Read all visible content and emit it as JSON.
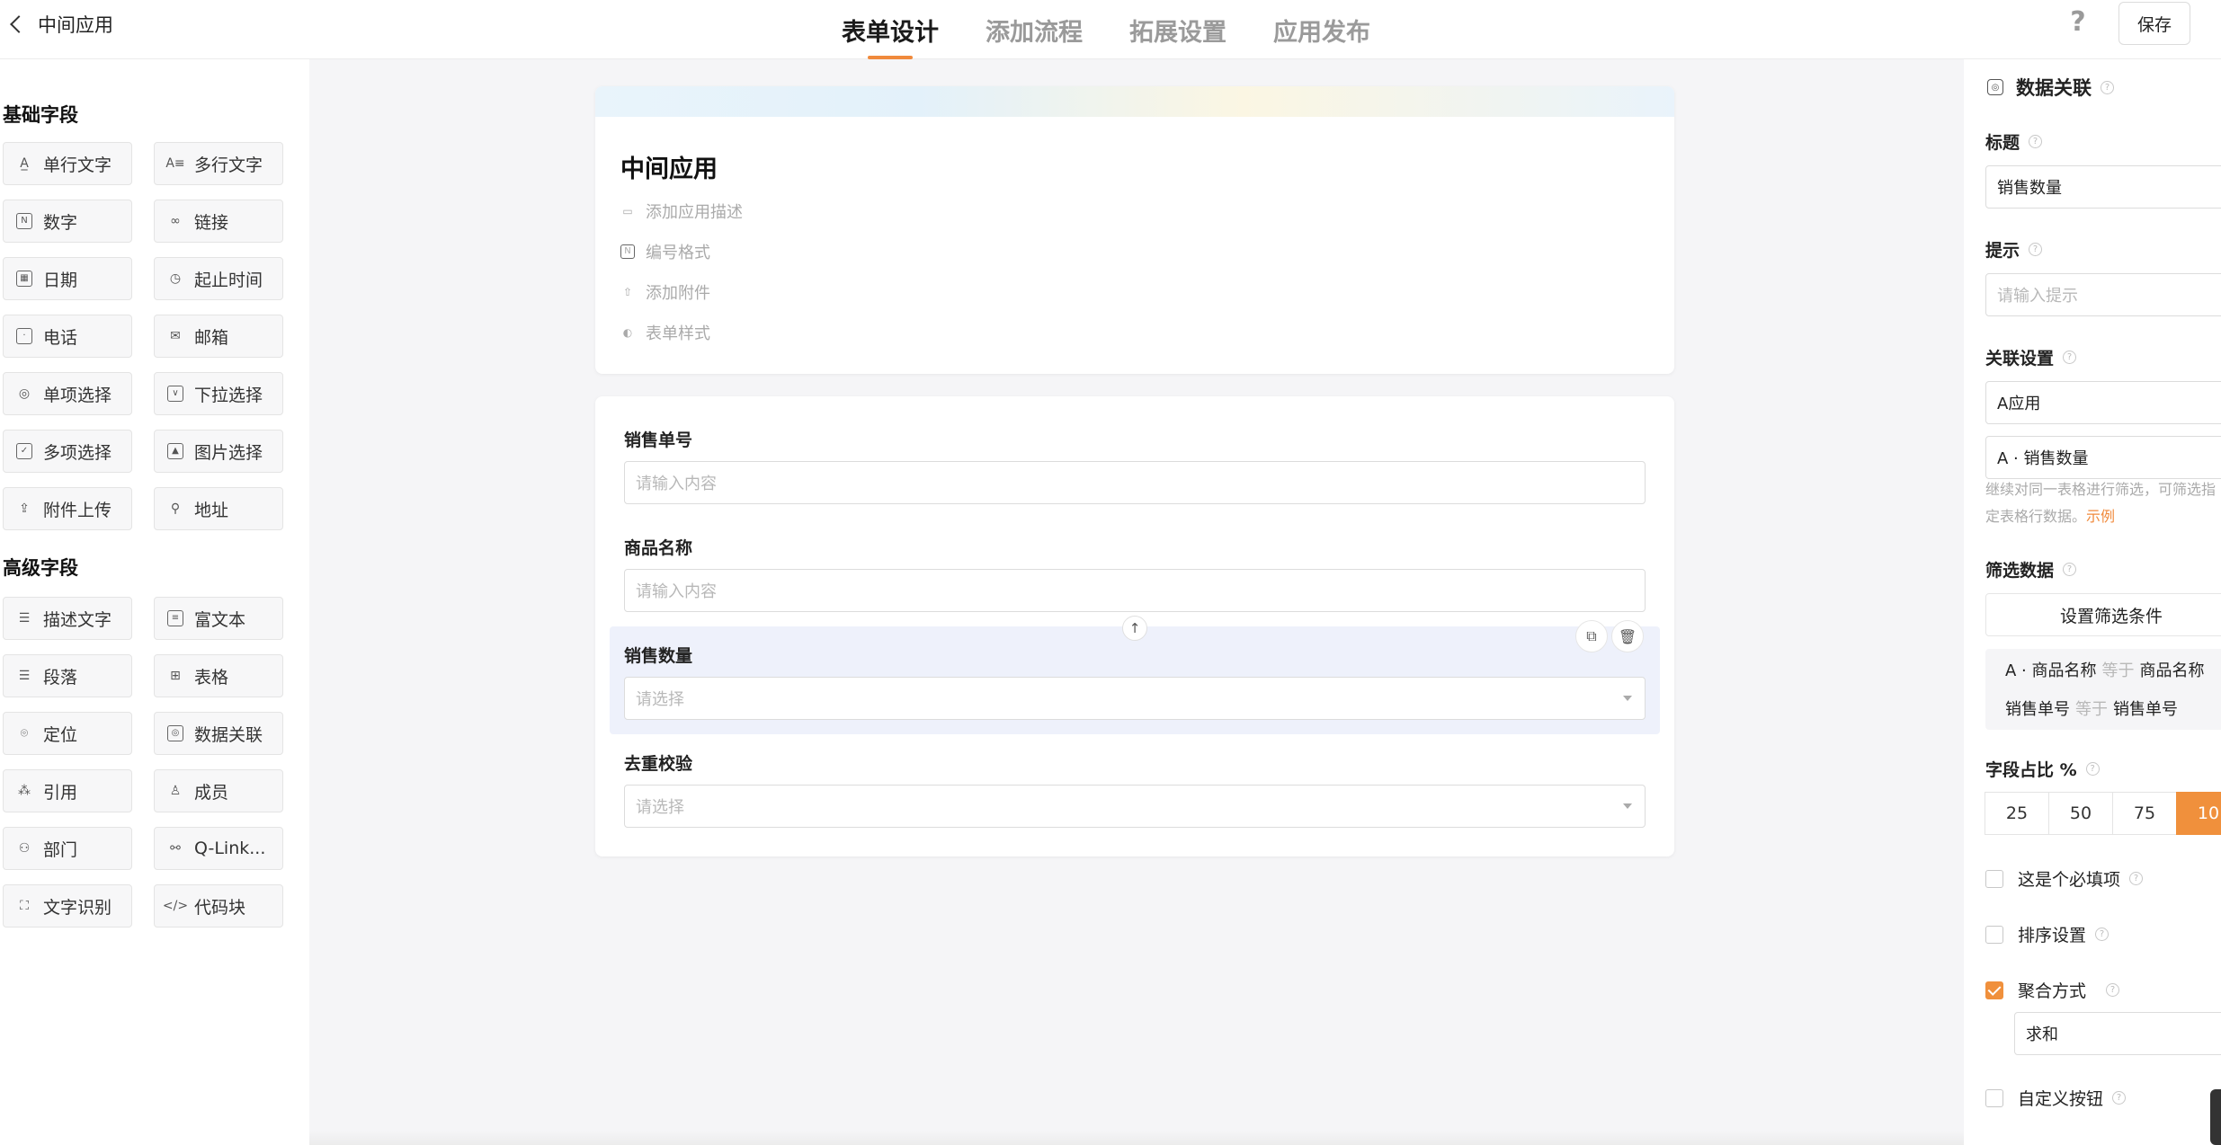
{
  "header": {
    "back_icon": "chevron-left-icon",
    "app_name": "中间应用",
    "tabs": [
      {
        "label": "表单设计",
        "active": true
      },
      {
        "label": "添加流程",
        "active": false
      },
      {
        "label": "拓展设置",
        "active": false
      },
      {
        "label": "应用发布",
        "active": false
      }
    ],
    "help_label": "?",
    "save_label": "保存",
    "accent_color": "#f08a3c"
  },
  "leftbar": {
    "basic_title": "基础字段",
    "basic_fields": [
      {
        "label": "单行文字",
        "icon": "text-icon"
      },
      {
        "label": "多行文字",
        "icon": "multiline-text-icon"
      },
      {
        "label": "数字",
        "icon": "number-icon"
      },
      {
        "label": "链接",
        "icon": "link-icon"
      },
      {
        "label": "日期",
        "icon": "calendar-icon"
      },
      {
        "label": "起止时间",
        "icon": "clock-icon"
      },
      {
        "label": "电话",
        "icon": "phone-icon"
      },
      {
        "label": "邮箱",
        "icon": "mail-icon"
      },
      {
        "label": "单项选择",
        "icon": "radio-icon"
      },
      {
        "label": "下拉选择",
        "icon": "dropdown-icon"
      },
      {
        "label": "多项选择",
        "icon": "checkbox-icon"
      },
      {
        "label": "图片选择",
        "icon": "image-icon"
      },
      {
        "label": "附件上传",
        "icon": "upload-icon"
      },
      {
        "label": "地址",
        "icon": "location-icon"
      }
    ],
    "advanced_title": "高级字段",
    "advanced_fields": [
      {
        "label": "描述文字",
        "icon": "description-icon"
      },
      {
        "label": "富文本",
        "icon": "rich-text-icon"
      },
      {
        "label": "段落",
        "icon": "paragraph-icon"
      },
      {
        "label": "表格",
        "icon": "table-icon"
      },
      {
        "label": "定位",
        "icon": "pin-icon"
      },
      {
        "label": "数据关联",
        "icon": "data-link-icon"
      },
      {
        "label": "引用",
        "icon": "reference-icon"
      },
      {
        "label": "成员",
        "icon": "user-icon"
      },
      {
        "label": "部门",
        "icon": "department-icon"
      },
      {
        "label": "Q-Link...",
        "icon": "qlink-icon"
      },
      {
        "label": "文字识别",
        "icon": "ocr-icon"
      },
      {
        "label": "代码块",
        "icon": "code-icon"
      }
    ]
  },
  "form_header": {
    "title": "中间应用",
    "meta": [
      {
        "label": "添加应用描述",
        "icon": "comment-icon"
      },
      {
        "label": "编号格式",
        "icon": "number-format-icon"
      },
      {
        "label": "添加附件",
        "icon": "upload-icon"
      },
      {
        "label": "表单样式",
        "icon": "palette-icon"
      }
    ]
  },
  "form_fields": [
    {
      "label": "销售单号",
      "placeholder": "请输入内容",
      "type": "text"
    },
    {
      "label": "商品名称",
      "placeholder": "请输入内容",
      "type": "text"
    },
    {
      "label": "销售数量",
      "placeholder": "请选择",
      "type": "select"
    },
    {
      "label": "去重校验",
      "placeholder": "请选择",
      "type": "select"
    }
  ],
  "field_actions": {
    "move_up": "arrow-up-icon",
    "copy": "copy-icon",
    "delete": "trash-icon"
  },
  "rightbar": {
    "field_type": "数据关联",
    "title_label": "标题",
    "title_value": "销售数量",
    "hint_label": "提示",
    "hint_placeholder": "请输入提示",
    "link_label": "关联设置",
    "link_app": "A应用",
    "link_field": "A · 销售数量",
    "link_desc": "继续对同一表格进行筛选，可筛选指定表格行数据。",
    "link_example": "示例",
    "filter_label": "筛选数据",
    "filter_button": "设置筛选条件",
    "conditions": [
      {
        "left": "A · 商品名称",
        "op": "等于",
        "right": "商品名称"
      },
      {
        "left": "销售单号",
        "op": "等于",
        "right": "销售单号"
      }
    ],
    "ratio_label": "字段占比 %",
    "ratio_options": [
      "25",
      "50",
      "75",
      "10"
    ],
    "ratio_selected": "10",
    "options": [
      {
        "label": "这是个必填项",
        "checked": false
      },
      {
        "label": "排序设置",
        "checked": false
      },
      {
        "label": "聚合方式",
        "checked": true
      },
      {
        "label": "自定义按钮",
        "checked": false
      }
    ],
    "aggregate_value": "求和"
  }
}
